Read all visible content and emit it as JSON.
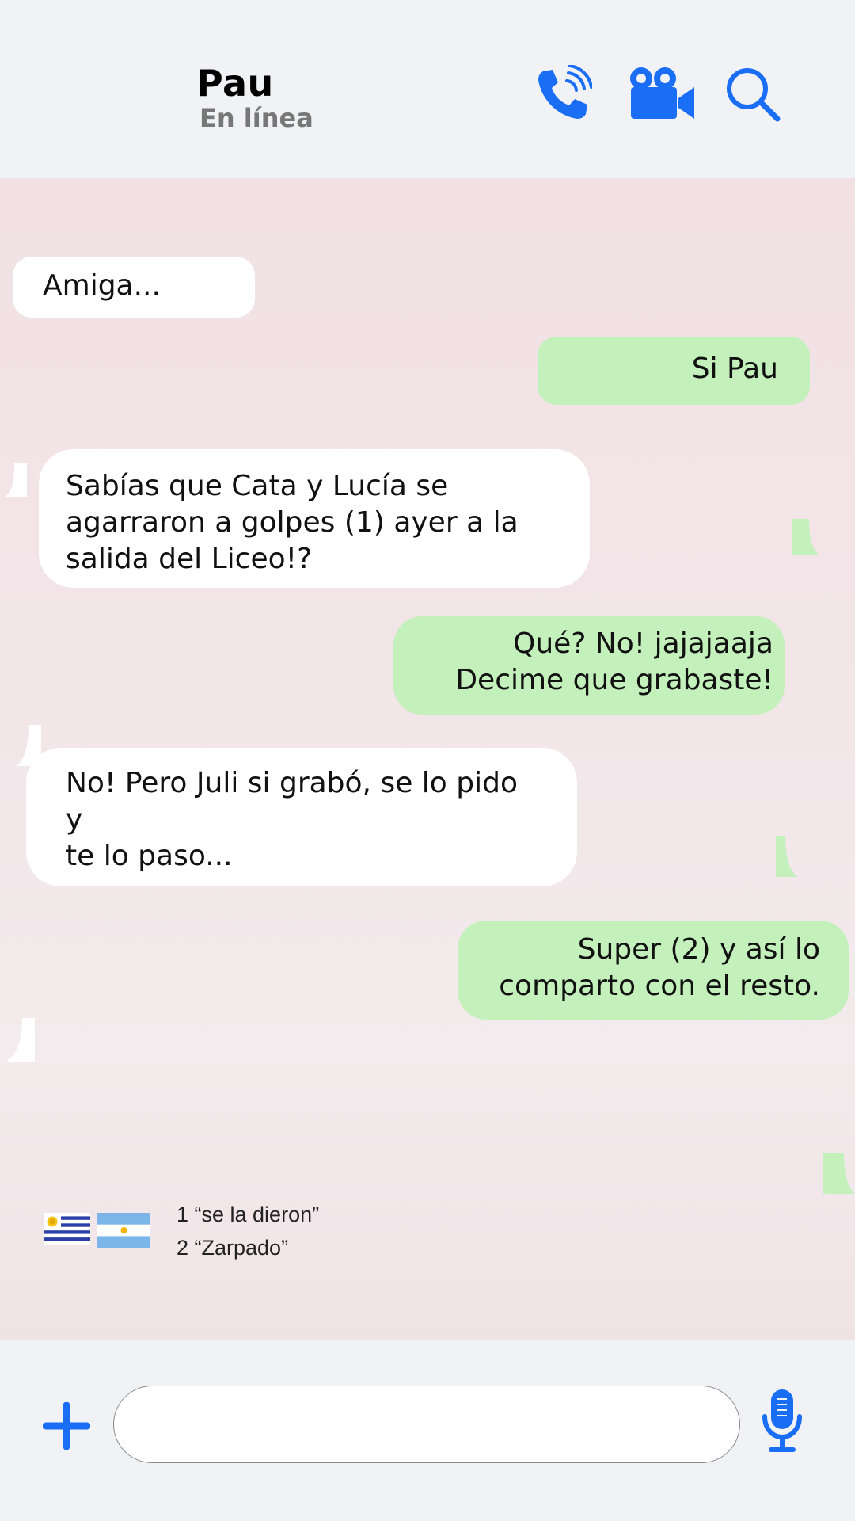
{
  "header": {
    "contact_name": "Pau",
    "status": "En línea",
    "icons": [
      "phone-call-icon",
      "video-camera-icon",
      "search-icon"
    ],
    "accent_color": "#1a6ef5"
  },
  "messages": [
    {
      "side": "in",
      "lines": [
        "Amiga..."
      ]
    },
    {
      "side": "out",
      "lines": [
        "Si Pau"
      ]
    },
    {
      "side": "in",
      "lines": [
        "Sabías que Cata y Lucía se",
        "agarraron a golpes (1) ayer a la",
        "salida del Liceo!?"
      ]
    },
    {
      "side": "out",
      "lines": [
        "Qué? No! jajajaaja",
        "Decime que grabaste!"
      ]
    },
    {
      "side": "in",
      "lines": [
        "No! Pero Juli si grabó, se lo pido y",
        "te lo paso..."
      ]
    },
    {
      "side": "out",
      "lines": [
        "Super (2) y así lo",
        "comparto con el resto."
      ]
    }
  ],
  "bubble_colors": {
    "incoming": "#ffffff",
    "outgoing": "#c4f0bb"
  },
  "glossary": {
    "flags": [
      "uruguay-flag",
      "argentina-flag"
    ],
    "notes": [
      "1 “se la dieron”",
      "2 “Zarpado”"
    ]
  },
  "composer": {
    "value": "",
    "placeholder": "",
    "icons": [
      "plus-icon",
      "microphone-icon"
    ]
  }
}
